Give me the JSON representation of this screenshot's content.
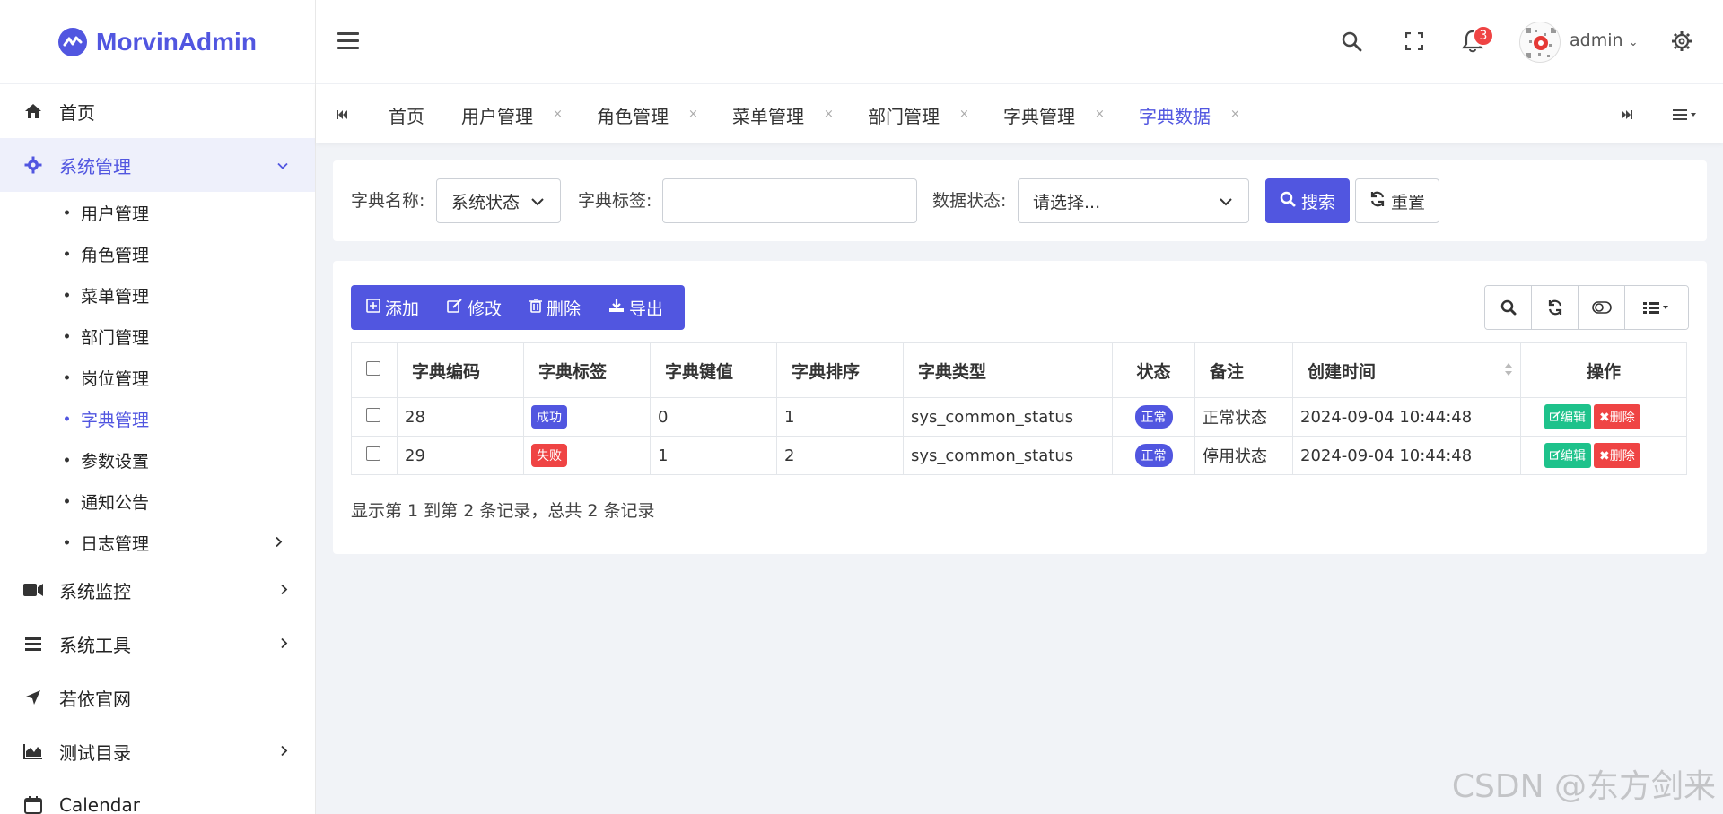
{
  "app": {
    "name": "MorvinAdmin",
    "brand_color": "#5156e0"
  },
  "sidebar": {
    "items": [
      {
        "label": "首页",
        "icon": "home-icon"
      },
      {
        "label": "系统管理",
        "icon": "gear-icon",
        "expanded": true
      },
      {
        "label": "系统监控",
        "icon": "video-icon"
      },
      {
        "label": "系统工具",
        "icon": "bars-icon"
      },
      {
        "label": "若依官网",
        "icon": "location-arrow-icon"
      },
      {
        "label": "测试目录",
        "icon": "area-chart-icon"
      },
      {
        "label": "Calendar",
        "icon": "calendar-icon"
      }
    ],
    "submenu": [
      {
        "label": "用户管理"
      },
      {
        "label": "角色管理"
      },
      {
        "label": "菜单管理"
      },
      {
        "label": "部门管理"
      },
      {
        "label": "岗位管理"
      },
      {
        "label": "字典管理",
        "active": true
      },
      {
        "label": "参数设置"
      },
      {
        "label": "通知公告"
      },
      {
        "label": "日志管理"
      }
    ]
  },
  "header": {
    "notification_count": "3",
    "user": "admin"
  },
  "tabs": [
    {
      "label": "首页"
    },
    {
      "label": "用户管理",
      "close": "×"
    },
    {
      "label": "角色管理",
      "close": "×"
    },
    {
      "label": "菜单管理",
      "close": "×"
    },
    {
      "label": "部门管理",
      "close": "×"
    },
    {
      "label": "字典管理",
      "close": "×"
    },
    {
      "label": "字典数据",
      "close": "×",
      "active": true
    }
  ],
  "search": {
    "dict_name_label": "字典名称:",
    "dict_name_value": "系统状态",
    "dict_label_label": "字典标签:",
    "dict_label_value": "",
    "status_label": "数据状态:",
    "status_placeholder": "请选择...",
    "search_button": "搜索",
    "reset_button": "重置"
  },
  "toolbar": {
    "add": "添加",
    "edit": "修改",
    "delete": "删除",
    "export": "导出"
  },
  "table": {
    "columns": [
      "字典编码",
      "字典标签",
      "字典键值",
      "字典排序",
      "字典类型",
      "状态",
      "备注",
      "创建时间",
      "操作"
    ],
    "rows": [
      {
        "code": "28",
        "label": "成功",
        "label_color": "#5156e0",
        "value": "0",
        "sort": "1",
        "type": "sys_common_status",
        "status": "正常",
        "remark": "正常状态",
        "created": "2024-09-04 10:44:48"
      },
      {
        "code": "29",
        "label": "失败",
        "label_color": "#ef4444",
        "value": "1",
        "sort": "2",
        "type": "sys_common_status",
        "status": "正常",
        "remark": "停用状态",
        "created": "2024-09-04 10:44:48"
      }
    ],
    "edit_label": "编辑",
    "delete_label": "删除",
    "edit_color": "#1ec28b",
    "delete_color": "#ef4444"
  },
  "pager": {
    "summary": "显示第 1 到第 2 条记录，总共 2 条记录"
  },
  "watermark": "CSDN @东方剑来"
}
